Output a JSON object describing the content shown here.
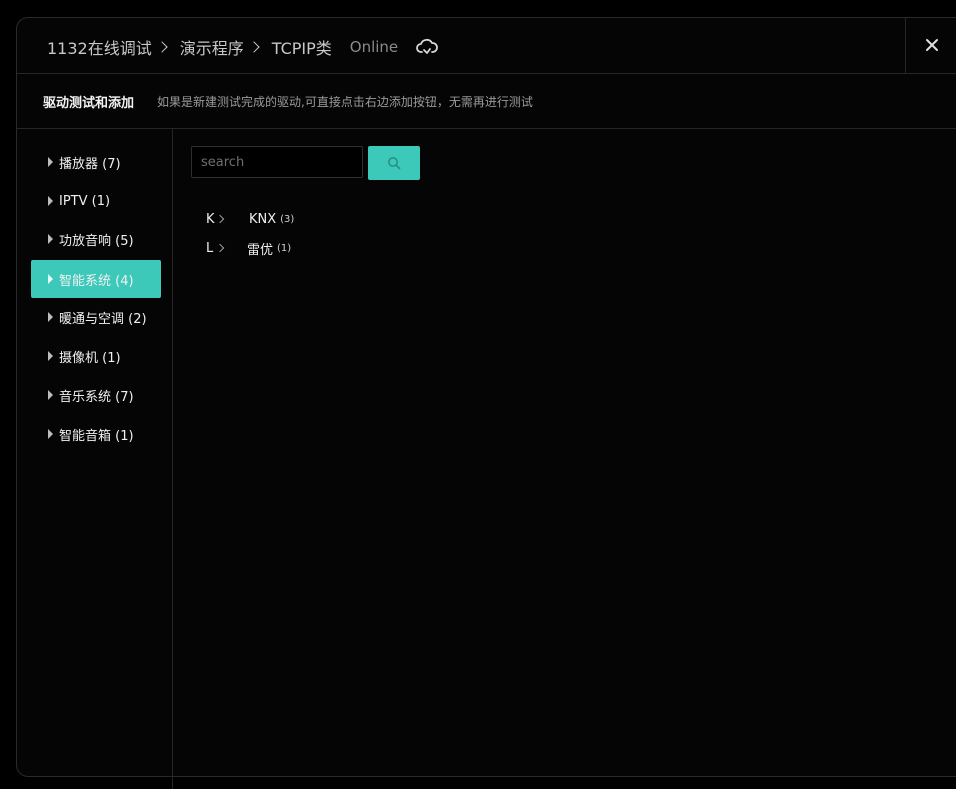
{
  "breadcrumb": [
    "1132在线调试",
    "演示程序",
    "TCPIP类"
  ],
  "status": "Online",
  "subheader": {
    "title": "驱动测试和添加",
    "description": "如果是新建测试完成的驱动,可直接点击右边添加按钮，无需再进行测试"
  },
  "categories": [
    {
      "label": "播放器 (7)",
      "active": false
    },
    {
      "label": "IPTV (1)",
      "active": false
    },
    {
      "label": "功放音响 (5)",
      "active": false
    },
    {
      "label": "智能系统 (4)",
      "active": true
    },
    {
      "label": "暖通与空调 (2)",
      "active": false
    },
    {
      "label": "摄像机 (1)",
      "active": false
    },
    {
      "label": "音乐系统 (7)",
      "active": false
    },
    {
      "label": "智能音箱 (1)",
      "active": false
    }
  ],
  "search": {
    "placeholder": "search",
    "value": ""
  },
  "groups": [
    {
      "letter": "K",
      "brand": "KNX",
      "count": "(3)"
    },
    {
      "letter": "L",
      "brand": "雷优",
      "count": "(1)"
    }
  ],
  "colors": {
    "accent": "#3cc9b9",
    "background": "#000000"
  }
}
